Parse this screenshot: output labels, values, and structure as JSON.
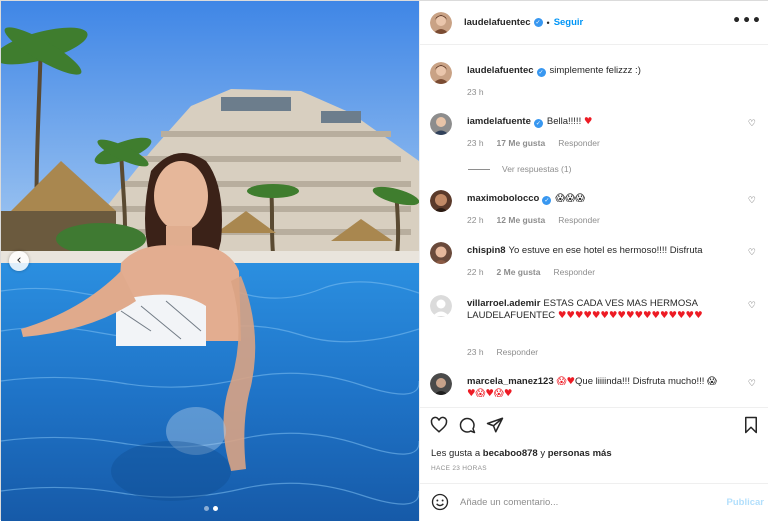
{
  "post": {
    "username": "laudelafuentec",
    "follow_label": "Seguir",
    "separator": "•",
    "more_label": "•••"
  },
  "caption": {
    "username": "laudelafuentec",
    "text": "simplemente felizzz :)",
    "time": "23 h"
  },
  "comments": [
    {
      "username": "iamdelafuente",
      "verified": true,
      "text": "Bella!!!!!",
      "hearts": "♥",
      "time": "23 h",
      "likes": "17 Me gusta",
      "reply": "Responder",
      "view_replies": "Ver respuestas (1)"
    },
    {
      "username": "maximobolocco",
      "verified": true,
      "text": "",
      "emoji": "😱😱😱",
      "time": "22 h",
      "likes": "12 Me gusta",
      "reply": "Responder"
    },
    {
      "username": "chispin8",
      "verified": false,
      "text": "Yo estuve en ese hotel es hermoso!!!! Disfruta",
      "time": "22 h",
      "likes": "2 Me gusta",
      "reply": "Responder"
    },
    {
      "username": "villarroel.ademir",
      "verified": false,
      "text": "ESTAS CADA VES MAS HERMOSA LAUDELAFUENTEC",
      "hearts": "♥♥♥♥♥♥♥♥♥♥♥♥♥♥♥♥♥",
      "time": "23 h",
      "reply": "Responder"
    },
    {
      "username": "marcela_manez123",
      "verified": false,
      "pre_emoji": "😱♥",
      "text": "Que liiiinda!!! Disfruta mucho!!!",
      "post_emoji": "😱",
      "hearts2": "♥😱♥😱♥"
    }
  ],
  "actions": {
    "like_icon": "heart-outline-icon",
    "comment_icon": "comment-icon",
    "share_icon": "share-icon",
    "save_icon": "bookmark-icon",
    "likes_prefix": "Les gusta a",
    "likes_user": "becaboo878",
    "likes_mid": "y",
    "likes_rest": "personas más",
    "time": "HACE 23 HORAS"
  },
  "add_comment": {
    "placeholder": "Añade un comentario...",
    "post_label": "Publicar"
  },
  "colors": {
    "accent": "#0095f6",
    "verified": "#3897f0",
    "heart": "#ed1b24",
    "muted": "#8e8e8e"
  }
}
